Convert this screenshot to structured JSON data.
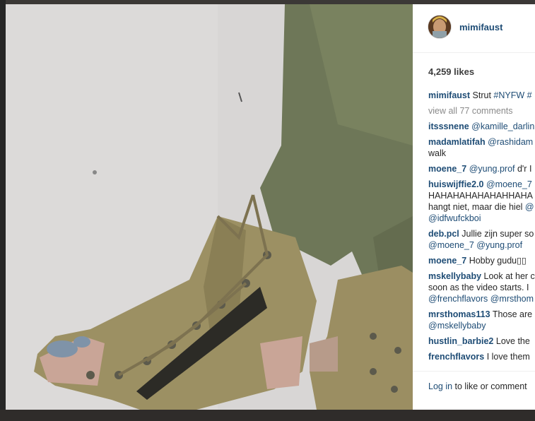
{
  "post": {
    "username": "mimifaust",
    "likes": "4,259 likes",
    "caption_user": "mimifaust",
    "caption_text": "Strut",
    "caption_tags": "#NYFW #",
    "view_all": "view all 77 comments"
  },
  "comments": [
    {
      "user": "itsssnene",
      "lines": [
        {
          "t": "",
          "m": "@kamille_darlin"
        }
      ]
    },
    {
      "user": "madamlatifah",
      "lines": [
        {
          "t": "",
          "m": "@rashidam"
        },
        {
          "t": "walk",
          "m": ""
        }
      ]
    },
    {
      "user": "moene_7",
      "lines": [
        {
          "t": "",
          "m": "@yung.prof",
          "after": " d'r I"
        }
      ]
    },
    {
      "user": "huiswijffie2.0",
      "lines": [
        {
          "t": "",
          "m": "@moene_7"
        },
        {
          "t": "HAHAHAHAHAHAHHAHA",
          "m": ""
        },
        {
          "t": "hangt niet, maar die hiel ",
          "m": "@"
        },
        {
          "t": "",
          "m": "@idfwufckboi"
        }
      ]
    },
    {
      "user": "deb.pcl",
      "lines": [
        {
          "t": "Jullie zijn super so",
          "m": ""
        },
        {
          "t": "",
          "m": "@moene_7 @yung.prof"
        }
      ]
    },
    {
      "user": "moene_7",
      "lines": [
        {
          "t": "Hobby gudu▯▯",
          "m": ""
        }
      ]
    },
    {
      "user": "mskellybaby",
      "lines": [
        {
          "t": "Look at her c",
          "m": ""
        },
        {
          "t": "soon as the video starts. I",
          "m": ""
        },
        {
          "t": "",
          "m": "@frenchflavors @mrsthom"
        }
      ]
    },
    {
      "user": "mrsthomas113",
      "lines": [
        {
          "t": "Those are",
          "m": ""
        },
        {
          "t": "",
          "m": "@mskellybaby"
        }
      ]
    },
    {
      "user": "hustlin_barbie2",
      "lines": [
        {
          "t": "Love the",
          "m": ""
        }
      ]
    },
    {
      "user": "frenchflavors",
      "lines": [
        {
          "t": "I love them",
          "m": ""
        }
      ]
    }
  ],
  "footer": {
    "login_link": "Log in",
    "login_text": " to like or comment"
  },
  "icons": {
    "avatar": "profile-avatar-image",
    "photo": "post-photo-boots"
  },
  "colors": {
    "link": "#1e4c75",
    "muted": "#8a8a8a",
    "text": "#262626"
  }
}
